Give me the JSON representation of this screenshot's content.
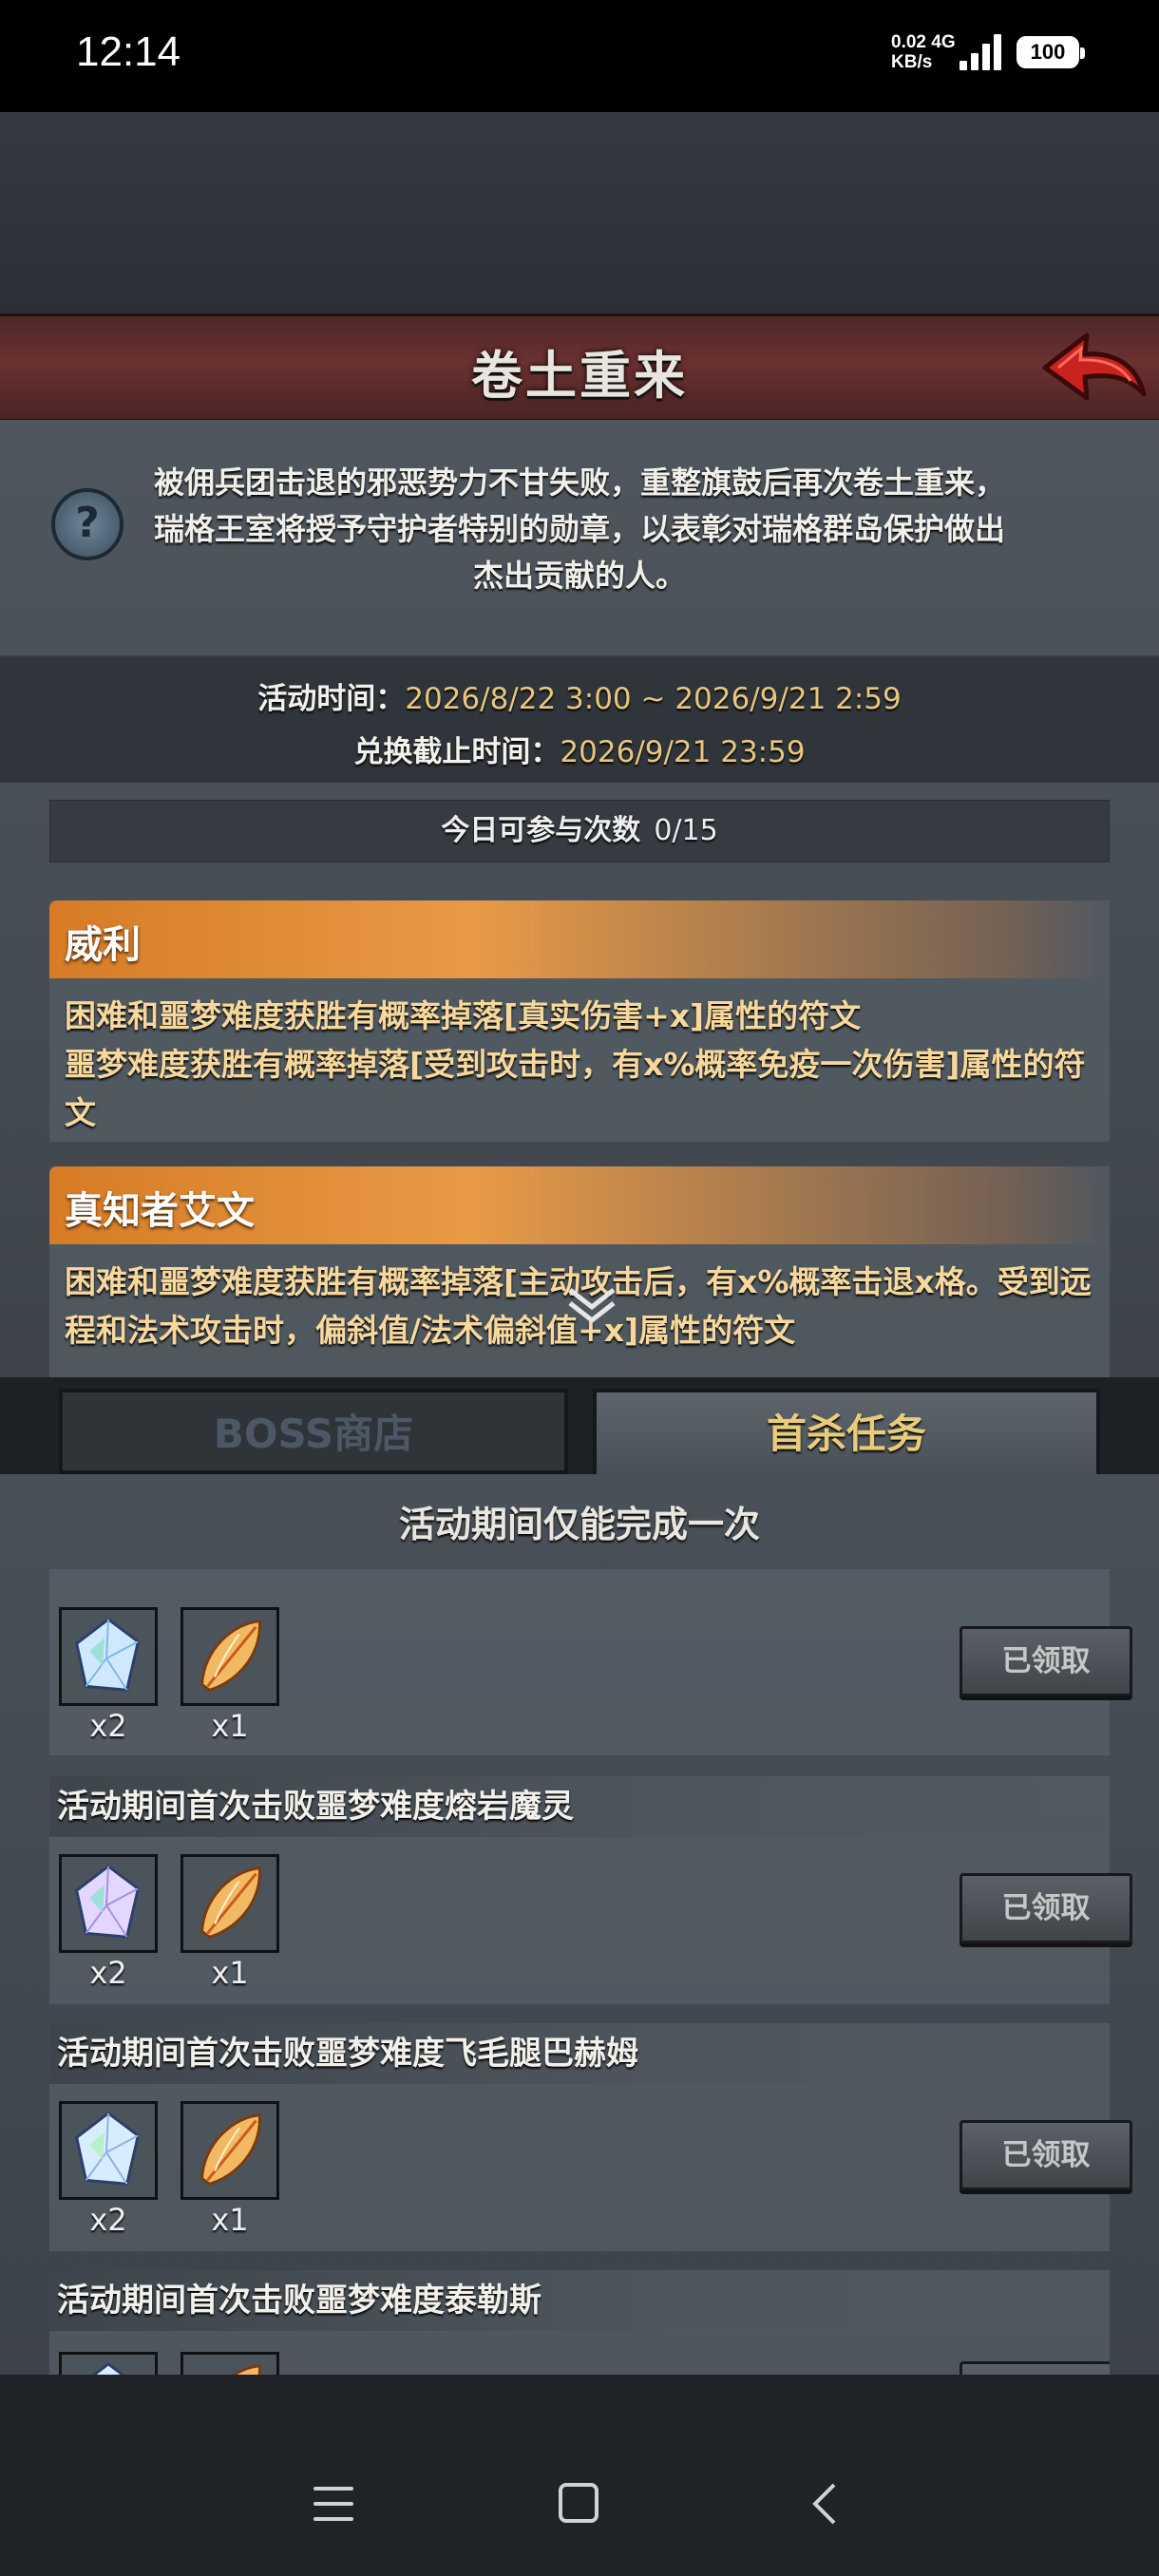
{
  "status_bar": {
    "time": "12:14",
    "net_speed": "0.02",
    "net_unit": "KB/s",
    "network_type": "4G",
    "battery": "100"
  },
  "header": {
    "title": "卷土重来",
    "back_icon": "red-arrow-back-icon"
  },
  "intro": {
    "help_icon": "question-icon",
    "description": "被佣兵团击退的邪恶势力不甘失败，重整旗鼓后再次卷土重来，瑞格王室将授予守护者特别的勋章，以表彰对瑞格群岛保护做出杰出贡献的人。"
  },
  "event_time": {
    "label": "活动时间：",
    "value": "2026/8/22 3:00 ~ 2026/9/21 2:59",
    "exchange_label": "兑换截止时间：",
    "exchange_value": "2026/9/21 23:59"
  },
  "daily": {
    "label": "今日可参与次数",
    "value": "0/15"
  },
  "bosses": [
    {
      "name": "威利",
      "text": "困难和噩梦难度获胜有概率掉落[真实伤害+x]属性的符文\n噩梦难度获胜有概率掉落[受到攻击时，有x%概率免疫一次伤害]属性的符文"
    },
    {
      "name": "真知者艾文",
      "text": "困难和噩梦难度获胜有概率掉落[主动攻击后，有x%概率击退x格。受到远程和法术攻击时，偏斜值/法术偏斜值+x]属性的符文"
    }
  ],
  "tabs": {
    "shop": "BOSS商店",
    "first_kill": "首杀任务"
  },
  "first_kill": {
    "header": "活动期间仅能完成一次",
    "tasks": [
      {
        "title": "",
        "rewards": [
          {
            "icon": "crystal-icon",
            "qty": "x2"
          },
          {
            "icon": "feather-icon",
            "qty": "x1"
          }
        ],
        "button": "已领取"
      },
      {
        "title": "活动期间首次击败噩梦难度熔岩魔灵",
        "rewards": [
          {
            "icon": "crystal-icon",
            "qty": "x2"
          },
          {
            "icon": "feather-icon",
            "qty": "x1"
          }
        ],
        "button": "已领取"
      },
      {
        "title": "活动期间首次击败噩梦难度飞毛腿巴赫姆",
        "rewards": [
          {
            "icon": "crystal-icon",
            "qty": "x2"
          },
          {
            "icon": "feather-icon",
            "qty": "x1"
          }
        ],
        "button": "已领取"
      },
      {
        "title": "活动期间首次击败噩梦难度泰勒斯",
        "rewards": [
          {
            "icon": "crystal-icon",
            "qty": ""
          },
          {
            "icon": "feather-icon",
            "qty": ""
          }
        ],
        "button": ""
      }
    ]
  },
  "colors": {
    "accent_gold": "#e7c77d",
    "title_bar": "#6b3131",
    "boss_header": "#e89a46",
    "boss_text": "#f6d89c"
  }
}
